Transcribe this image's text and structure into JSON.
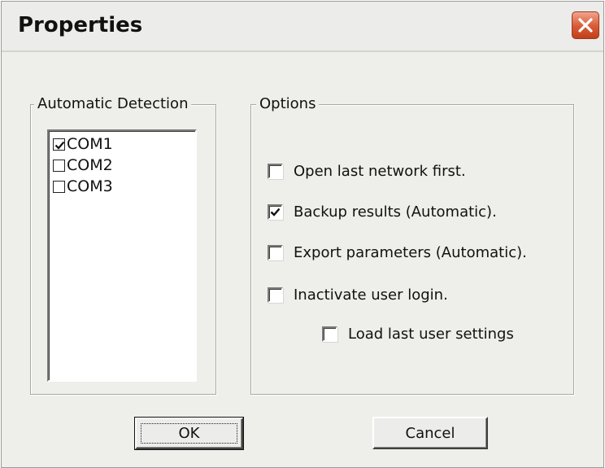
{
  "window": {
    "title": "Properties"
  },
  "detection": {
    "legend": "Automatic Detection",
    "ports": [
      {
        "label": "COM1",
        "checked": true
      },
      {
        "label": "COM2",
        "checked": false
      },
      {
        "label": "COM3",
        "checked": false
      }
    ]
  },
  "options": {
    "legend": "Options",
    "items": [
      {
        "label": "Open last network first.",
        "checked": false
      },
      {
        "label": "Backup results (Automatic).",
        "checked": true
      },
      {
        "label": "Export  parameters (Automatic).",
        "checked": false
      },
      {
        "label": "Inactivate user login.",
        "checked": false
      },
      {
        "label": "Load last user settings",
        "checked": false
      }
    ]
  },
  "buttons": {
    "ok": "OK",
    "cancel": "Cancel"
  },
  "colors": {
    "close_button": "#d85a35",
    "dialog_bg": "#eeeeea"
  }
}
